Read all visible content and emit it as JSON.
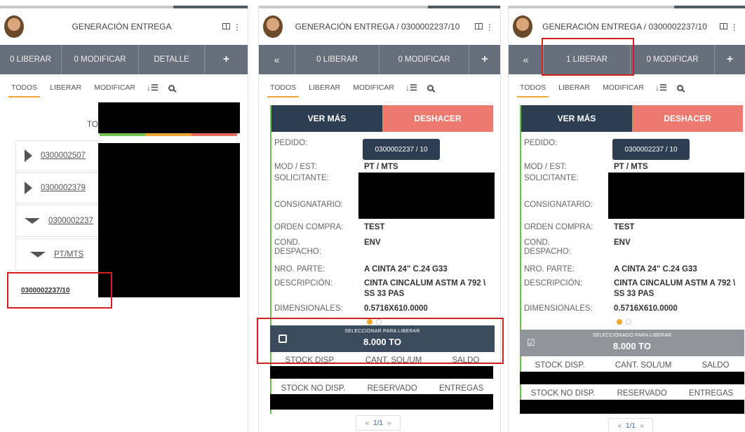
{
  "panel1": {
    "title": "GENERACIÓN ENTREGA",
    "actions": [
      "0 LIBERAR",
      "0 MODIFICAR",
      "DETALLE",
      "+"
    ],
    "tabs": [
      "TODOS",
      "LIBERAR",
      "MODIFICAR"
    ],
    "total_label": "TO",
    "status_colors": [
      "#6cc24a",
      "#f0a830",
      "#ec6a5e"
    ],
    "orders": [
      "0300002507",
      "0300002379",
      "0300002237"
    ],
    "sub_item": "PT/MTS",
    "sub_sub_item": "0300002237/10"
  },
  "panel2": {
    "title": "GENERACIÓN ENTREGA / 0300002237/10",
    "back": "«",
    "actions": [
      "0 LIBERAR",
      "0 MODIFICAR",
      "+"
    ],
    "tabs": [
      "TODOS",
      "LIBERAR",
      "MODIFICAR"
    ],
    "btn_vermas": "VER MÁS",
    "btn_deshacer": "DESHACER",
    "pedido_label": "PEDIDO:",
    "pedido_value": "0300002237 / 10",
    "modest_label": "MOD / EST:",
    "modest_value": "PT / MTS",
    "solicitante_label": "SOLICITANTE:",
    "consignatario_label": "CONSIGNATARIO:",
    "orden_label": "ORDEN COMPRA:",
    "orden_value": "TEST",
    "cond_label1": "COND.",
    "cond_label2": "DESPACHO:",
    "cond_value": "ENV",
    "parte_label": "NRO. PARTE:",
    "parte_value": "A CINTA 24\" C.24  G33",
    "desc_label": "DESCRIPCIÓN:",
    "desc_value1": "CINTA CINCALUM ASTM A 792 \\",
    "desc_value2": "SS 33 PAS",
    "dim_label": "DIMENSIONALES:",
    "dim_value": "0.5716X610.0000",
    "select_small": "SELECCIONAR PARA LIBERAR",
    "select_big": "8.000 TO",
    "stock_headers": [
      "STOCK DISP.",
      "CANT. SOL/UM",
      "SALDO"
    ],
    "stock_headers2": [
      "STOCK NO DISP.",
      "RESERVADO",
      "ENTREGAS"
    ],
    "pages_prev": "«",
    "pages_label": "1/1",
    "pages_next": "»"
  },
  "panel3": {
    "title": "GENERACIÓN ENTREGA / 0300002237/10",
    "back": "«",
    "actions": [
      "1 LIBERAR",
      "0 MODIFICAR",
      "+"
    ],
    "tabs": [
      "TODOS",
      "LIBERAR",
      "MODIFICAR"
    ],
    "btn_vermas": "VER MÁS",
    "btn_deshacer": "DESHACER",
    "pedido_label": "PEDIDO:",
    "pedido_value": "0300002237 / 10",
    "modest_label": "MOD / EST:",
    "modest_value": "PT / MTS",
    "solicitante_label": "SOLICITANTE:",
    "consignatario_label": "CONSIGNATARIO:",
    "orden_label": "ORDEN COMPRA:",
    "orden_value": "TEST",
    "cond_label1": "COND.",
    "cond_label2": "DESPACHO:",
    "cond_value": "ENV",
    "parte_label": "NRO. PARTE:",
    "parte_value": "A CINTA 24\" C.24  G33",
    "desc_label": "DESCRIPCIÓN:",
    "desc_value1": "CINTA CINCALUM ASTM A 792 \\",
    "desc_value2": "SS 33 PAS",
    "dim_label": "DIMENSIONALES:",
    "dim_value": "0.5716X610.0000",
    "select_small": "SELECCIONADO PARA LIBERAR",
    "select_big": "8.000 TO",
    "stock_headers": [
      "STOCK DISP.",
      "CANT. SOL/UM",
      "SALDO"
    ],
    "stock_headers2": [
      "STOCK NO DISP.",
      "RESERVADO",
      "ENTREGAS"
    ],
    "pages_prev": "«",
    "pages_label": "1/1",
    "pages_next": "»"
  },
  "icons": {
    "split": "split-view-icon",
    "more": "more-vertical-icon",
    "sort": "sort-icon",
    "search": "search-icon"
  },
  "colors": {
    "action_bar": "#67707a",
    "navy": "#2e3e52",
    "salmon": "#ec7a6e",
    "accent_orange": "#f0a830",
    "highlight_red": "#d62020"
  }
}
